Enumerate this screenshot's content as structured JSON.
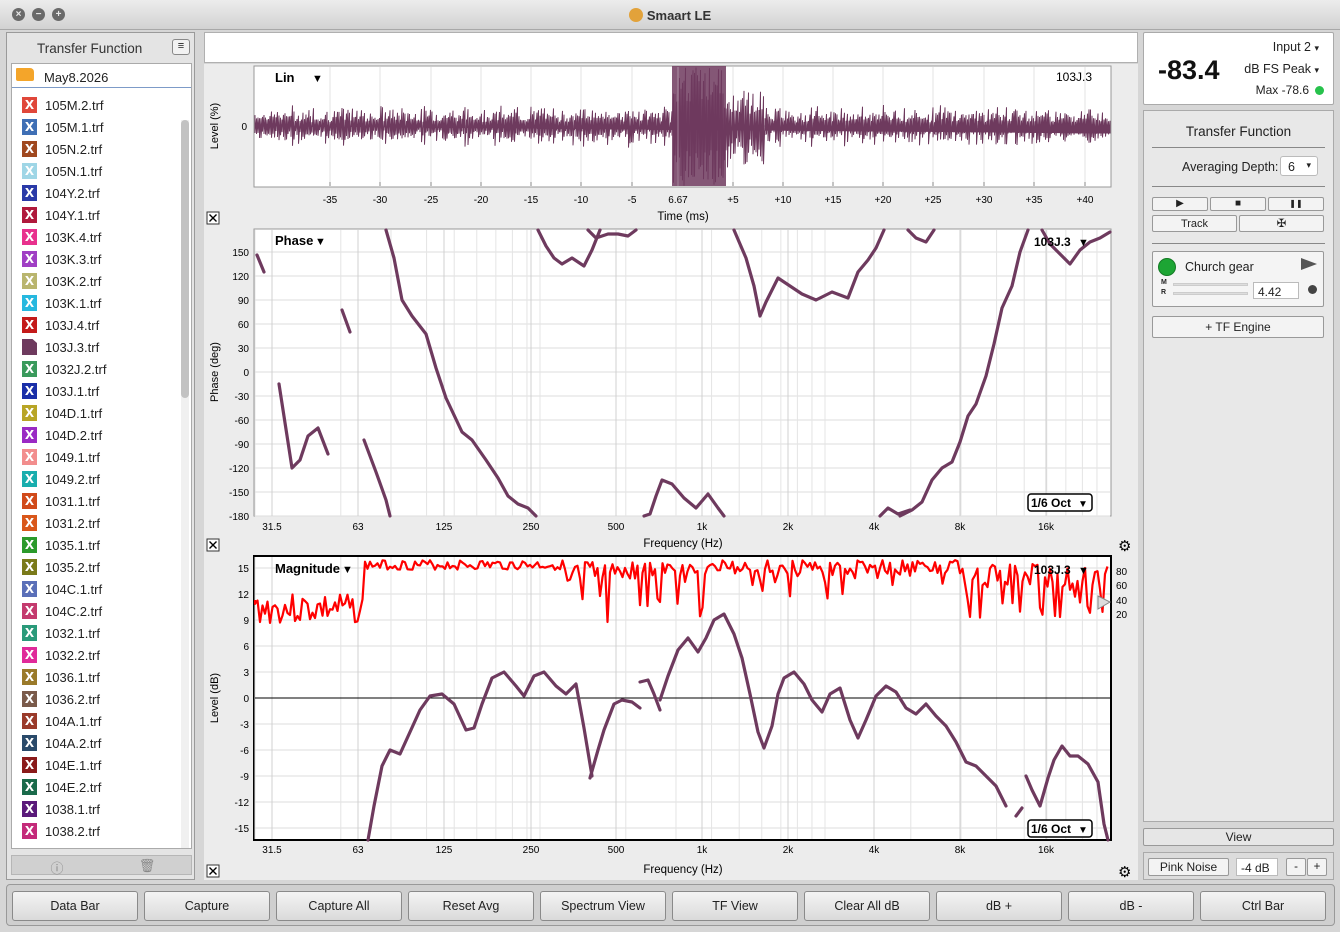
{
  "window": {
    "title": "Smaart LE"
  },
  "sidebar": {
    "title": "Transfer Function",
    "folder": "May8.2026",
    "files": [
      {
        "name": "105M.2.trf",
        "color": "#e0473a"
      },
      {
        "name": "105M.1.trf",
        "color": "#3f6fb5"
      },
      {
        "name": "105N.2.trf",
        "color": "#a0481f"
      },
      {
        "name": "105N.1.trf",
        "color": "#9fd6e6"
      },
      {
        "name": "104Y.2.trf",
        "color": "#2a3aa8"
      },
      {
        "name": "104Y.1.trf",
        "color": "#b0193c"
      },
      {
        "name": "103K.4.trf",
        "color": "#e8318d"
      },
      {
        "name": "103K.3.trf",
        "color": "#a03fc4"
      },
      {
        "name": "103K.2.trf",
        "color": "#b9b56e"
      },
      {
        "name": "103K.1.trf",
        "color": "#26b8df"
      },
      {
        "name": "103J.4.trf",
        "color": "#c41a1a"
      },
      {
        "name": "103J.3.trf",
        "color": "#6e3a5e"
      },
      {
        "name": "1032J.2.trf",
        "color": "#3a9a5c"
      },
      {
        "name": "103J.1.trf",
        "color": "#1a2fa8"
      },
      {
        "name": "104D.1.trf",
        "color": "#b8a526"
      },
      {
        "name": "104D.2.trf",
        "color": "#9a2ac4"
      },
      {
        "name": "1049.1.trf",
        "color": "#f28d8d"
      },
      {
        "name": "1049.2.trf",
        "color": "#19aeae"
      },
      {
        "name": "1031.1.trf",
        "color": "#d14a1a"
      },
      {
        "name": "1031.2.trf",
        "color": "#d9571a"
      },
      {
        "name": "1035.1.trf",
        "color": "#2b9a2b"
      },
      {
        "name": "1035.2.trf",
        "color": "#7a7a1a"
      },
      {
        "name": "104C.1.trf",
        "color": "#5a6fb8"
      },
      {
        "name": "104C.2.trf",
        "color": "#c43a6e"
      },
      {
        "name": "1032.1.trf",
        "color": "#2a9a7a"
      },
      {
        "name": "1032.2.trf",
        "color": "#e02a9a"
      },
      {
        "name": "1036.1.trf",
        "color": "#9a7a2a"
      },
      {
        "name": "1036.2.trf",
        "color": "#7a5a4a"
      },
      {
        "name": "104A.1.trf",
        "color": "#9a3a2a"
      },
      {
        "name": "104A.2.trf",
        "color": "#2a4a6a"
      },
      {
        "name": "104E.1.trf",
        "color": "#8a1a1a"
      },
      {
        "name": "104E.2.trf",
        "color": "#1a6a4a"
      },
      {
        "name": "1038.1.trf",
        "color": "#5a1a7a"
      },
      {
        "name": "1038.2.trf",
        "color": "#c42a7a"
      }
    ]
  },
  "panes": {
    "trace_name": "103J.3",
    "trace_color": "#6e3a5e",
    "live_color": "#ff0000",
    "smoothing": "1/6 Oct",
    "impulse": {
      "mode": "Lin",
      "ylabel": "Level (%)",
      "xlabel": "Time (ms)",
      "y_tick": "0",
      "delay_label": "6.67",
      "x_ticks": [
        "-35",
        "-30",
        "-25",
        "-20",
        "-15",
        "-10",
        "-5",
        "6.67",
        "+5",
        "+10",
        "+15",
        "+20",
        "+25",
        "+30",
        "+35",
        "+40"
      ]
    },
    "phase": {
      "mode": "Phase",
      "ylabel": "Phase (deg)",
      "xlabel": "Frequency (Hz)",
      "y_ticks": [
        "150",
        "120",
        "90",
        "60",
        "30",
        "0",
        "-30",
        "-60",
        "-90",
        "-120",
        "-150",
        "-180"
      ],
      "x_ticks": [
        "31.5",
        "63",
        "125",
        "250",
        "500",
        "1k",
        "2k",
        "4k",
        "8k",
        "16k"
      ]
    },
    "magnitude": {
      "mode": "Magnitude",
      "ylabel": "Level (dB)",
      "xlabel": "Frequency (Hz)",
      "y_ticks": [
        "15",
        "12",
        "9",
        "6",
        "3",
        "0",
        "-3",
        "-6",
        "-9",
        "-12",
        "-15"
      ],
      "x_ticks": [
        "31.5",
        "63",
        "125",
        "250",
        "500",
        "1k",
        "2k",
        "4k",
        "8k",
        "16k"
      ],
      "coherence_ticks": [
        "80",
        "60",
        "40",
        "20"
      ]
    }
  },
  "meter": {
    "value": "-83.4",
    "input": "Input 2",
    "unit": "dB FS Peak",
    "max": "Max -78.6"
  },
  "control": {
    "title": "Transfer Function",
    "averaging_label": "Averaging Depth:",
    "averaging_value": "6",
    "play": "▶",
    "stop": "■",
    "pause": "❚❚",
    "track": "Track",
    "tools": "✠",
    "engine": {
      "name": "Church gear",
      "m": "M",
      "r": "R",
      "value": "4.42"
    },
    "add_engine": "+ TF Engine",
    "view": "View",
    "pink_noise": "Pink Noise",
    "pink_level": "-4 dB",
    "minus": "-",
    "plus": "+"
  },
  "toolbar": [
    "Data Bar",
    "Capture",
    "Capture All",
    "Reset Avg",
    "Spectrum View",
    "TF View",
    "Clear All dB",
    "dB +",
    "dB -",
    "Ctrl Bar"
  ]
}
